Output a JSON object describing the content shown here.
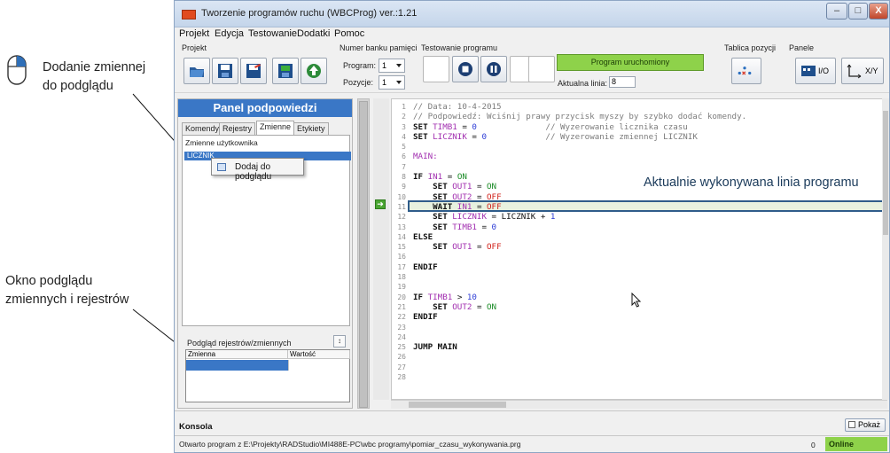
{
  "annotations": {
    "add_watch_line1": "Dodanie zmiennej",
    "add_watch_line2": "do podglądu",
    "watch_window_line1": "Okno podglądu",
    "watch_window_line2": "zmiennych i rejestrów",
    "current_line": "Aktualnie wykonywana linia programu"
  },
  "window": {
    "title": "Tworzenie programów ruchu (WBCProg) ver.:1.21",
    "controls": {
      "minimize": "–",
      "maximize": "□",
      "close": "X"
    }
  },
  "menu": [
    "Projekt",
    "Edycja",
    "Testowanie",
    "Dodatki",
    "Pomoc"
  ],
  "toolbar": {
    "project_label": "Projekt",
    "memory_bank_label": "Numer banku pamięci",
    "program_label": "Program:",
    "program_value": "1",
    "positions_label": "Pozycje:",
    "positions_value": "1",
    "testing_label": "Testowanie programu",
    "status_text": "Program uruchomiony",
    "current_line_label": "Aktualna linia:",
    "current_line_value": "8",
    "position_table_label": "Tablica pozycji",
    "panels_label": "Panele",
    "io_label": "I/O",
    "xy_label": "X/Y"
  },
  "hints_panel": {
    "title": "Panel podpowiedzi",
    "tabs": [
      "Komendy",
      "Rejestry",
      "Zmienne",
      "Etykiety"
    ],
    "active_tab": "Zmienne",
    "user_vars_label": "Zmienne użytkownika",
    "selected_var": "LICZNIK",
    "context_menu_item": "Dodaj do podglądu",
    "watch_label": "Podgląd rejestrów/zmiennych",
    "watch_col_var": "Zmienna",
    "watch_col_value": "Wartość"
  },
  "editor": {
    "line_numbers": [
      "1",
      "2",
      "3",
      "4",
      "5",
      "6",
      "7",
      "8",
      "9",
      "10",
      "11",
      "12",
      "13",
      "14",
      "15",
      "16",
      "17",
      "18",
      "19",
      "20",
      "21",
      "22",
      "23",
      "24",
      "25",
      "26",
      "27",
      "28"
    ],
    "current_line": 8,
    "lines": [
      [
        {
          "t": "// Data: 10-4-2015",
          "c": "c-comment"
        }
      ],
      [
        {
          "t": "// Podpowiedź: Wciśnij prawy przycisk myszy by szybko dodać komendy.",
          "c": "c-comment"
        }
      ],
      [
        {
          "t": "SET ",
          "c": "c-kw"
        },
        {
          "t": "TIMB1",
          "c": "c-var"
        },
        {
          "t": " = ",
          "c": ""
        },
        {
          "t": "0",
          "c": "c-num"
        },
        {
          "t": "              // Wyzerowanie licznika czasu",
          "c": "c-comment"
        }
      ],
      [
        {
          "t": "SET ",
          "c": "c-kw"
        },
        {
          "t": "LICZNIK",
          "c": "c-var"
        },
        {
          "t": " = ",
          "c": ""
        },
        {
          "t": "0",
          "c": "c-num"
        },
        {
          "t": "            // Wyzerowanie zmiennej LICZNIK",
          "c": "c-comment"
        }
      ],
      [],
      [
        {
          "t": "MAIN:",
          "c": "c-label"
        }
      ],
      [],
      [
        {
          "t": "IF ",
          "c": "c-kw"
        },
        {
          "t": "IN1",
          "c": "c-var"
        },
        {
          "t": " = ",
          "c": ""
        },
        {
          "t": "ON",
          "c": "c-on"
        }
      ],
      [
        {
          "t": "    SET ",
          "c": "c-kw"
        },
        {
          "t": "OUT1",
          "c": "c-var"
        },
        {
          "t": " = ",
          "c": ""
        },
        {
          "t": "ON",
          "c": "c-on"
        }
      ],
      [
        {
          "t": "    SET ",
          "c": "c-kw"
        },
        {
          "t": "OUT2",
          "c": "c-var"
        },
        {
          "t": " = ",
          "c": ""
        },
        {
          "t": "OFF",
          "c": "c-off"
        }
      ],
      [
        {
          "t": "    WAIT ",
          "c": "c-kw"
        },
        {
          "t": "IN1",
          "c": "c-var"
        },
        {
          "t": " = ",
          "c": ""
        },
        {
          "t": "OFF",
          "c": "c-off"
        }
      ],
      [
        {
          "t": "    SET ",
          "c": "c-kw"
        },
        {
          "t": "LICZNIK",
          "c": "c-var"
        },
        {
          "t": " = LICZNIK + ",
          "c": ""
        },
        {
          "t": "1",
          "c": "c-num"
        }
      ],
      [
        {
          "t": "    SET ",
          "c": "c-kw"
        },
        {
          "t": "TIMB1",
          "c": "c-var"
        },
        {
          "t": " = ",
          "c": ""
        },
        {
          "t": "0",
          "c": "c-num"
        }
      ],
      [
        {
          "t": "ELSE",
          "c": "c-kw"
        }
      ],
      [
        {
          "t": "    SET ",
          "c": "c-kw"
        },
        {
          "t": "OUT1",
          "c": "c-var"
        },
        {
          "t": " = ",
          "c": ""
        },
        {
          "t": "OFF",
          "c": "c-off"
        }
      ],
      [],
      [
        {
          "t": "ENDIF",
          "c": "c-kw"
        }
      ],
      [],
      [],
      [
        {
          "t": "IF ",
          "c": "c-kw"
        },
        {
          "t": "TIMB1",
          "c": "c-var"
        },
        {
          "t": " > ",
          "c": ""
        },
        {
          "t": "10",
          "c": "c-num"
        }
      ],
      [
        {
          "t": "    SET ",
          "c": "c-kw"
        },
        {
          "t": "OUT2",
          "c": "c-var"
        },
        {
          "t": " = ",
          "c": ""
        },
        {
          "t": "ON",
          "c": "c-on"
        }
      ],
      [
        {
          "t": "ENDIF",
          "c": "c-kw"
        }
      ],
      [],
      [],
      [
        {
          "t": "JUMP MAIN",
          "c": "c-kw"
        }
      ],
      [],
      [],
      []
    ]
  },
  "console": {
    "label": "Konsola",
    "show_button": "Pokaż",
    "status_path": "Otwarto program z E:\\Projekty\\RADStudio\\MI488E-PC\\wbc programy\\pomiar_czasu_wykonywania.prg",
    "count": "0",
    "online": "Online"
  },
  "colors": {
    "accent": "#3a77c6",
    "status_green": "#8ed24a",
    "highlight_border": "#2f5c8a"
  }
}
